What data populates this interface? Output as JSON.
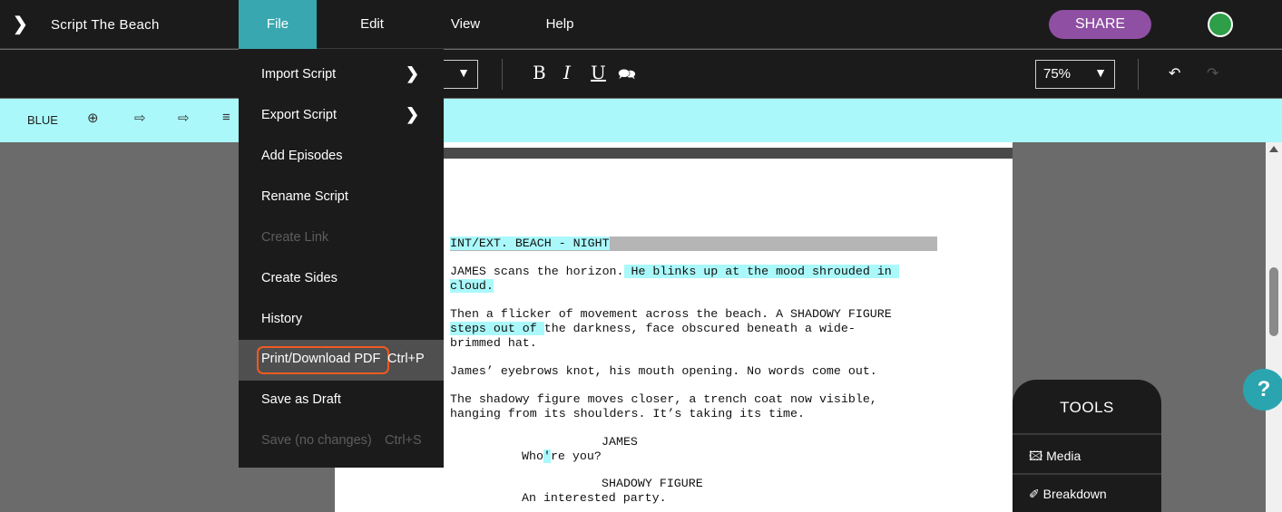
{
  "app": {
    "title": "Script The Beach"
  },
  "menubar": {
    "items": [
      "File",
      "Edit",
      "View",
      "Help"
    ]
  },
  "share_label": "SHARE",
  "format_toolbar": {
    "bold": "B",
    "italic": "I",
    "underline": "U",
    "zoom": "75%"
  },
  "revision_toolbar": {
    "revision_color": "BLUE"
  },
  "file_menu": {
    "items": [
      {
        "label": "Import Script",
        "submenu": true
      },
      {
        "label": "Export Script",
        "submenu": true
      },
      {
        "label": "Add Episodes"
      },
      {
        "label": "Rename Script"
      },
      {
        "label": "Create Link",
        "disabled": true
      },
      {
        "label": "Create Sides"
      },
      {
        "label": "History"
      },
      {
        "label": "Print/Download PDF",
        "shortcut": "Ctrl+P",
        "highlighted": true
      },
      {
        "label": "Save as Draft"
      },
      {
        "label": "Save (no changes)",
        "shortcut": "Ctrl+S",
        "disabled": true
      }
    ]
  },
  "script": {
    "scene_heading": "INT/EXT. BEACH - NIGHT",
    "action_1_a": "JAMES scans the horizon.",
    "action_1_b": " He blinks up at the mood shrouded in ",
    "action_1_c": "cloud.",
    "action_2_a": "Then a flicker of movement across the beach. A SHADOWY FIGURE",
    "action_2_b": "steps out of ",
    "action_2_c": "the darkness, face obscured beneath a wide-",
    "action_2_d": "brimmed hat.",
    "action_3": "James’ eyebrows knot, his mouth opening. No words come out.",
    "action_4_a": "The shadowy figure moves closer, a trench coat now visible,",
    "action_4_b": "hanging from its shoulders. It’s taking its time.",
    "char_1": "JAMES",
    "dialog_1_a": "Who",
    "dialog_1_b": "'",
    "dialog_1_c": "re you?",
    "char_2": "SHADOWY FIGURE",
    "dialog_2": "An interested party."
  },
  "tools": {
    "title": "TOOLS",
    "items": [
      "Media",
      "Breakdown"
    ]
  },
  "help_label": "?"
}
